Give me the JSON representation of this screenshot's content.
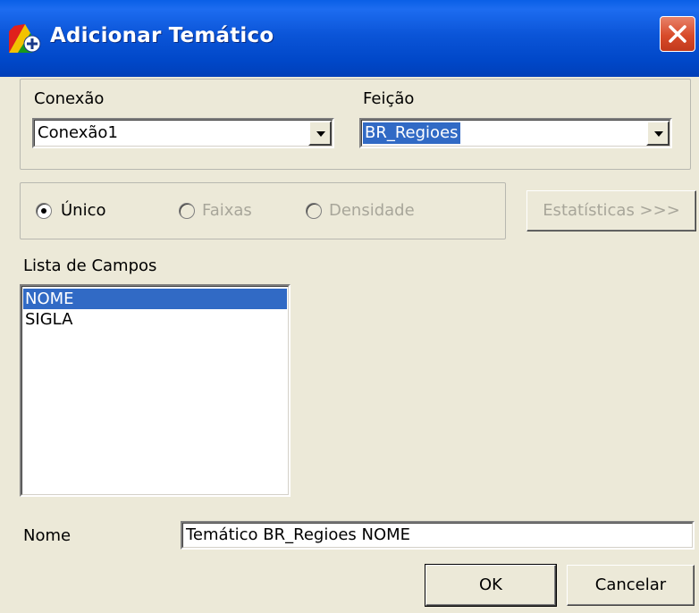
{
  "window": {
    "title": "Adicionar Temático"
  },
  "connection": {
    "label": "Conexão",
    "value": "Conexão1"
  },
  "feature": {
    "label": "Feição",
    "value": "BR_Regioes"
  },
  "mode": {
    "options": [
      {
        "label": "Único",
        "selected": true,
        "enabled": true
      },
      {
        "label": "Faixas",
        "selected": false,
        "enabled": false
      },
      {
        "label": "Densidade",
        "selected": false,
        "enabled": false
      }
    ]
  },
  "statistics_button": {
    "label": "Estatísticas >>>",
    "enabled": false
  },
  "fields": {
    "label": "Lista de Campos",
    "items": [
      {
        "label": "NOME",
        "selected": true
      },
      {
        "label": "SIGLA",
        "selected": false
      }
    ]
  },
  "name": {
    "label": "Nome",
    "value": "Temático BR_Regioes NOME"
  },
  "buttons": {
    "ok": "OK",
    "cancel": "Cancelar"
  },
  "colors": {
    "titlebar": "#0054e3",
    "selection": "#316ac5",
    "dialog": "#ece9d8"
  }
}
